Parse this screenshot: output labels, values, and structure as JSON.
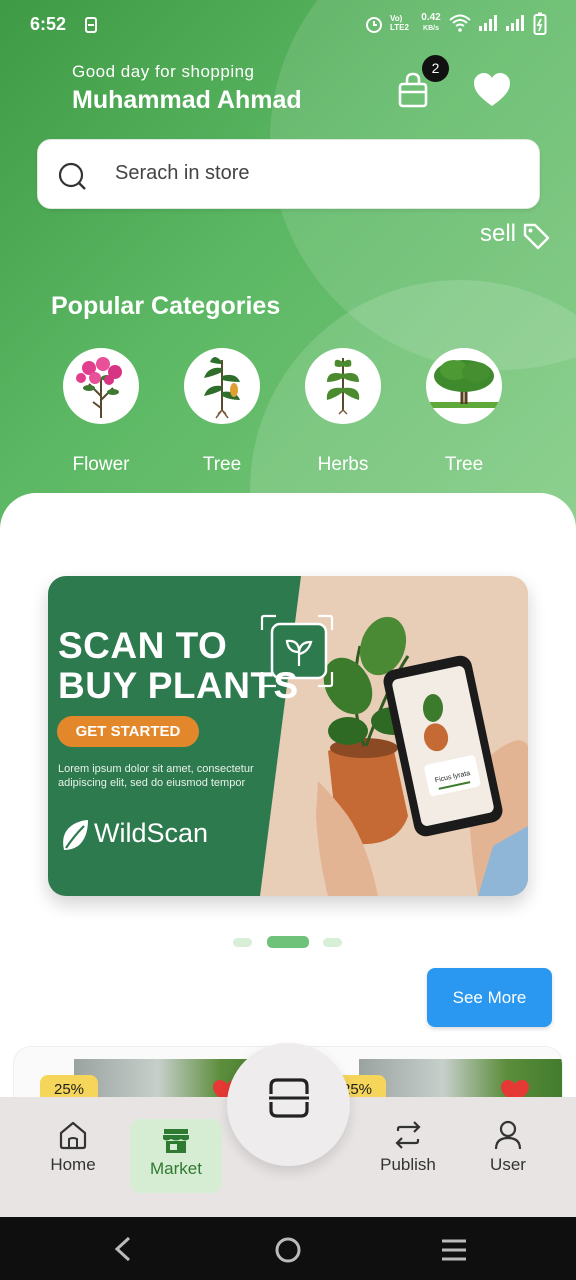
{
  "status": {
    "time": "6:52",
    "net_speed": "0.42",
    "net_unit": "KB/s",
    "lte_top": "Vo) LTE2",
    "lte_label": "Vo) LTE2"
  },
  "header": {
    "greeting": "Good day for shopping",
    "username": "Muhammad Ahmad",
    "cart_badge": "2"
  },
  "search": {
    "placeholder": "Serach in store"
  },
  "sell_label": "sell",
  "categories": {
    "title": "Popular Categories",
    "items": [
      {
        "label": "Flower",
        "icon": "flower-plant-icon"
      },
      {
        "label": "Tree",
        "icon": "sapling-icon"
      },
      {
        "label": "Herbs",
        "icon": "herb-icon"
      },
      {
        "label": "Tree",
        "icon": "tree-icon"
      }
    ]
  },
  "banner": {
    "title_line1": "SCAN TO",
    "title_line2": "BUY PLANTS",
    "button": "GET STARTED",
    "description": "Lorem ipsum dolor sit amet, consectetur adipiscing elit, sed do eiusmod tempor",
    "brand": "WildScan",
    "phone_label": "Ficus lyrata"
  },
  "carousel": {
    "count": 3,
    "active_index": 1
  },
  "see_more": "See More",
  "products": [
    {
      "discount": "25%"
    },
    {
      "discount": "25%"
    }
  ],
  "nav": {
    "items": [
      {
        "label": "Home",
        "icon": "home-icon"
      },
      {
        "label": "Market",
        "icon": "store-icon",
        "active": true
      },
      {
        "label": "Publish",
        "icon": "exchange-icon"
      },
      {
        "label": "User",
        "icon": "user-icon"
      }
    ],
    "center_icon": "scan-icon"
  },
  "colors": {
    "primary_green": "#4caf50",
    "accent_blue": "#2a98f0",
    "banner_green": "#2e7a4f",
    "cta_orange": "#e3882a"
  }
}
